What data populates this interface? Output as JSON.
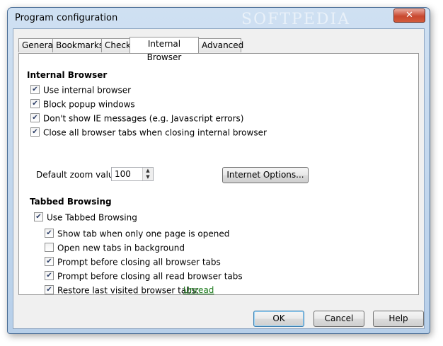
{
  "window": {
    "title": "Program configuration",
    "watermark": "SOFTPEDIA",
    "close_glyph": "✕"
  },
  "tabs": [
    {
      "label": "General"
    },
    {
      "label": "Bookmarks"
    },
    {
      "label": "Check"
    },
    {
      "label": "Internal Browser",
      "active": true
    },
    {
      "label": "Advanced"
    }
  ],
  "internal_browser": {
    "title": "Internal Browser",
    "options": [
      {
        "label": "Use internal browser",
        "checked": true
      },
      {
        "label": "Block popup windows",
        "checked": true
      },
      {
        "label": "Don't show IE messages (e.g. Javascript errors)",
        "checked": true
      },
      {
        "label": "Close all browser tabs when closing internal browser",
        "checked": true
      }
    ],
    "zoom_label": "Default zoom value:",
    "zoom_value": "100",
    "internet_options_label": "Internet Options..."
  },
  "tabbed_browsing": {
    "title": "Tabbed Browsing",
    "use_label": "Use Tabbed Browsing",
    "use_checked": true,
    "options": [
      {
        "label": "Show tab when only one page is opened",
        "checked": true
      },
      {
        "label": "Open new tabs in background",
        "checked": false
      },
      {
        "label": "Prompt before closing all browser tabs",
        "checked": true
      },
      {
        "label": "Prompt before closing all read browser tabs",
        "checked": true
      },
      {
        "label": "Restore last visited browser tabs:",
        "checked": true
      }
    ],
    "restore_link": "Unread"
  },
  "footer": {
    "ok_label": "OK",
    "cancel_label": "Cancel",
    "help_label": "Help"
  },
  "glyphs": {
    "check": "✔",
    "spin_up": "▲",
    "spin_down": "▼"
  }
}
